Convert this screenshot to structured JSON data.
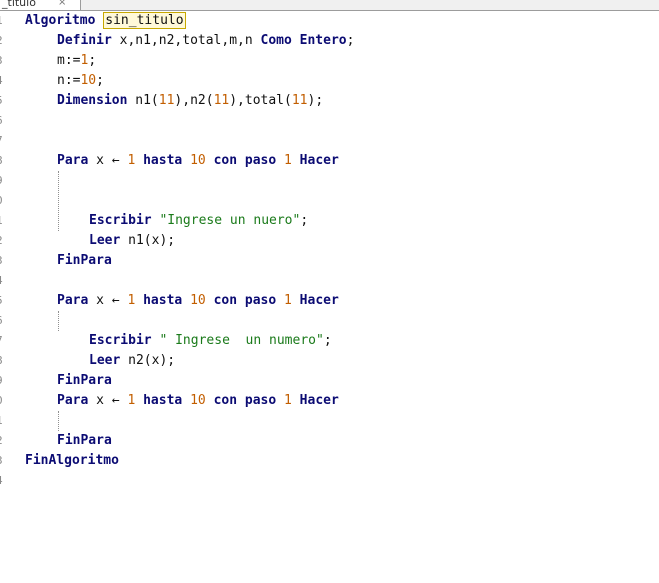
{
  "tab": {
    "label": "_titulo",
    "close": "×"
  },
  "lines": [
    {
      "n": "1",
      "indent": 0,
      "tokens": [
        {
          "t": "Algoritmo",
          "c": "kw"
        },
        {
          "t": " "
        },
        {
          "t": "sin_titulo",
          "c": "hl"
        }
      ]
    },
    {
      "n": "2",
      "indent": 1,
      "tokens": [
        {
          "t": "Definir",
          "c": "kw"
        },
        {
          "t": " x,n1,n2,total,m,n "
        },
        {
          "t": "Como",
          "c": "kw"
        },
        {
          "t": " "
        },
        {
          "t": "Entero",
          "c": "kw"
        },
        {
          "t": ";"
        }
      ]
    },
    {
      "n": "3",
      "indent": 1,
      "tokens": [
        {
          "t": "m:="
        },
        {
          "t": "1",
          "c": "num"
        },
        {
          "t": ";"
        }
      ]
    },
    {
      "n": "4",
      "indent": 1,
      "tokens": [
        {
          "t": "n:="
        },
        {
          "t": "10",
          "c": "num"
        },
        {
          "t": ";"
        }
      ]
    },
    {
      "n": "5",
      "indent": 1,
      "tokens": [
        {
          "t": "Dimension",
          "c": "kw"
        },
        {
          "t": " n1("
        },
        {
          "t": "11",
          "c": "num"
        },
        {
          "t": "),n2("
        },
        {
          "t": "11",
          "c": "num"
        },
        {
          "t": "),total("
        },
        {
          "t": "11",
          "c": "num"
        },
        {
          "t": ");"
        }
      ]
    },
    {
      "n": "6",
      "indent": 0,
      "tokens": []
    },
    {
      "n": "7",
      "indent": 0,
      "tokens": []
    },
    {
      "n": "8",
      "indent": 1,
      "tokens": [
        {
          "t": "Para",
          "c": "kw"
        },
        {
          "t": " x "
        },
        {
          "t": "←"
        },
        {
          "t": " "
        },
        {
          "t": "1",
          "c": "num"
        },
        {
          "t": " "
        },
        {
          "t": "hasta",
          "c": "kw"
        },
        {
          "t": " "
        },
        {
          "t": "10",
          "c": "num"
        },
        {
          "t": " "
        },
        {
          "t": "con paso",
          "c": "kw"
        },
        {
          "t": " "
        },
        {
          "t": "1",
          "c": "num"
        },
        {
          "t": " "
        },
        {
          "t": "Hacer",
          "c": "kw"
        }
      ]
    },
    {
      "n": "9",
      "indent": 0,
      "tokens": []
    },
    {
      "n": "0",
      "indent": 0,
      "tokens": []
    },
    {
      "n": "1",
      "indent": 2,
      "tokens": [
        {
          "t": "Escribir",
          "c": "kw"
        },
        {
          "t": " "
        },
        {
          "t": "\"Ingrese un nuero\"",
          "c": "str"
        },
        {
          "t": ";"
        }
      ]
    },
    {
      "n": "2",
      "indent": 2,
      "tokens": [
        {
          "t": "Leer",
          "c": "kw"
        },
        {
          "t": " n1(x);"
        }
      ]
    },
    {
      "n": "3",
      "indent": 1,
      "tokens": [
        {
          "t": "FinPara",
          "c": "kw"
        }
      ]
    },
    {
      "n": "4",
      "indent": 0,
      "tokens": []
    },
    {
      "n": "5",
      "indent": 1,
      "tokens": [
        {
          "t": "Para",
          "c": "kw"
        },
        {
          "t": " x "
        },
        {
          "t": "←"
        },
        {
          "t": " "
        },
        {
          "t": "1",
          "c": "num"
        },
        {
          "t": " "
        },
        {
          "t": "hasta",
          "c": "kw"
        },
        {
          "t": " "
        },
        {
          "t": "10",
          "c": "num"
        },
        {
          "t": " "
        },
        {
          "t": "con paso",
          "c": "kw"
        },
        {
          "t": " "
        },
        {
          "t": "1",
          "c": "num"
        },
        {
          "t": " "
        },
        {
          "t": "Hacer",
          "c": "kw"
        }
      ]
    },
    {
      "n": "6",
      "indent": 0,
      "tokens": []
    },
    {
      "n": "7",
      "indent": 2,
      "tokens": [
        {
          "t": "Escribir",
          "c": "kw"
        },
        {
          "t": " "
        },
        {
          "t": "\" Ingrese  un numero\"",
          "c": "str"
        },
        {
          "t": ";"
        }
      ]
    },
    {
      "n": "8",
      "indent": 2,
      "tokens": [
        {
          "t": "Leer",
          "c": "kw"
        },
        {
          "t": " n2(x);"
        }
      ]
    },
    {
      "n": "9",
      "indent": 1,
      "tokens": [
        {
          "t": "FinPara",
          "c": "kw"
        }
      ]
    },
    {
      "n": "0",
      "indent": 1,
      "tokens": [
        {
          "t": "Para",
          "c": "kw"
        },
        {
          "t": " x "
        },
        {
          "t": "←"
        },
        {
          "t": " "
        },
        {
          "t": "1",
          "c": "num"
        },
        {
          "t": " "
        },
        {
          "t": "hasta",
          "c": "kw"
        },
        {
          "t": " "
        },
        {
          "t": "10",
          "c": "num"
        },
        {
          "t": " "
        },
        {
          "t": "con paso",
          "c": "kw"
        },
        {
          "t": " "
        },
        {
          "t": "1",
          "c": "num"
        },
        {
          "t": " "
        },
        {
          "t": "Hacer",
          "c": "kw"
        }
      ]
    },
    {
      "n": "1",
      "indent": 0,
      "tokens": []
    },
    {
      "n": "2",
      "indent": 1,
      "tokens": [
        {
          "t": "FinPara",
          "c": "kw"
        }
      ]
    },
    {
      "n": "3",
      "indent": 0,
      "tokens": [
        {
          "t": "FinAlgoritmo",
          "c": "kw"
        }
      ]
    },
    {
      "n": "4",
      "indent": 0,
      "tokens": []
    }
  ]
}
